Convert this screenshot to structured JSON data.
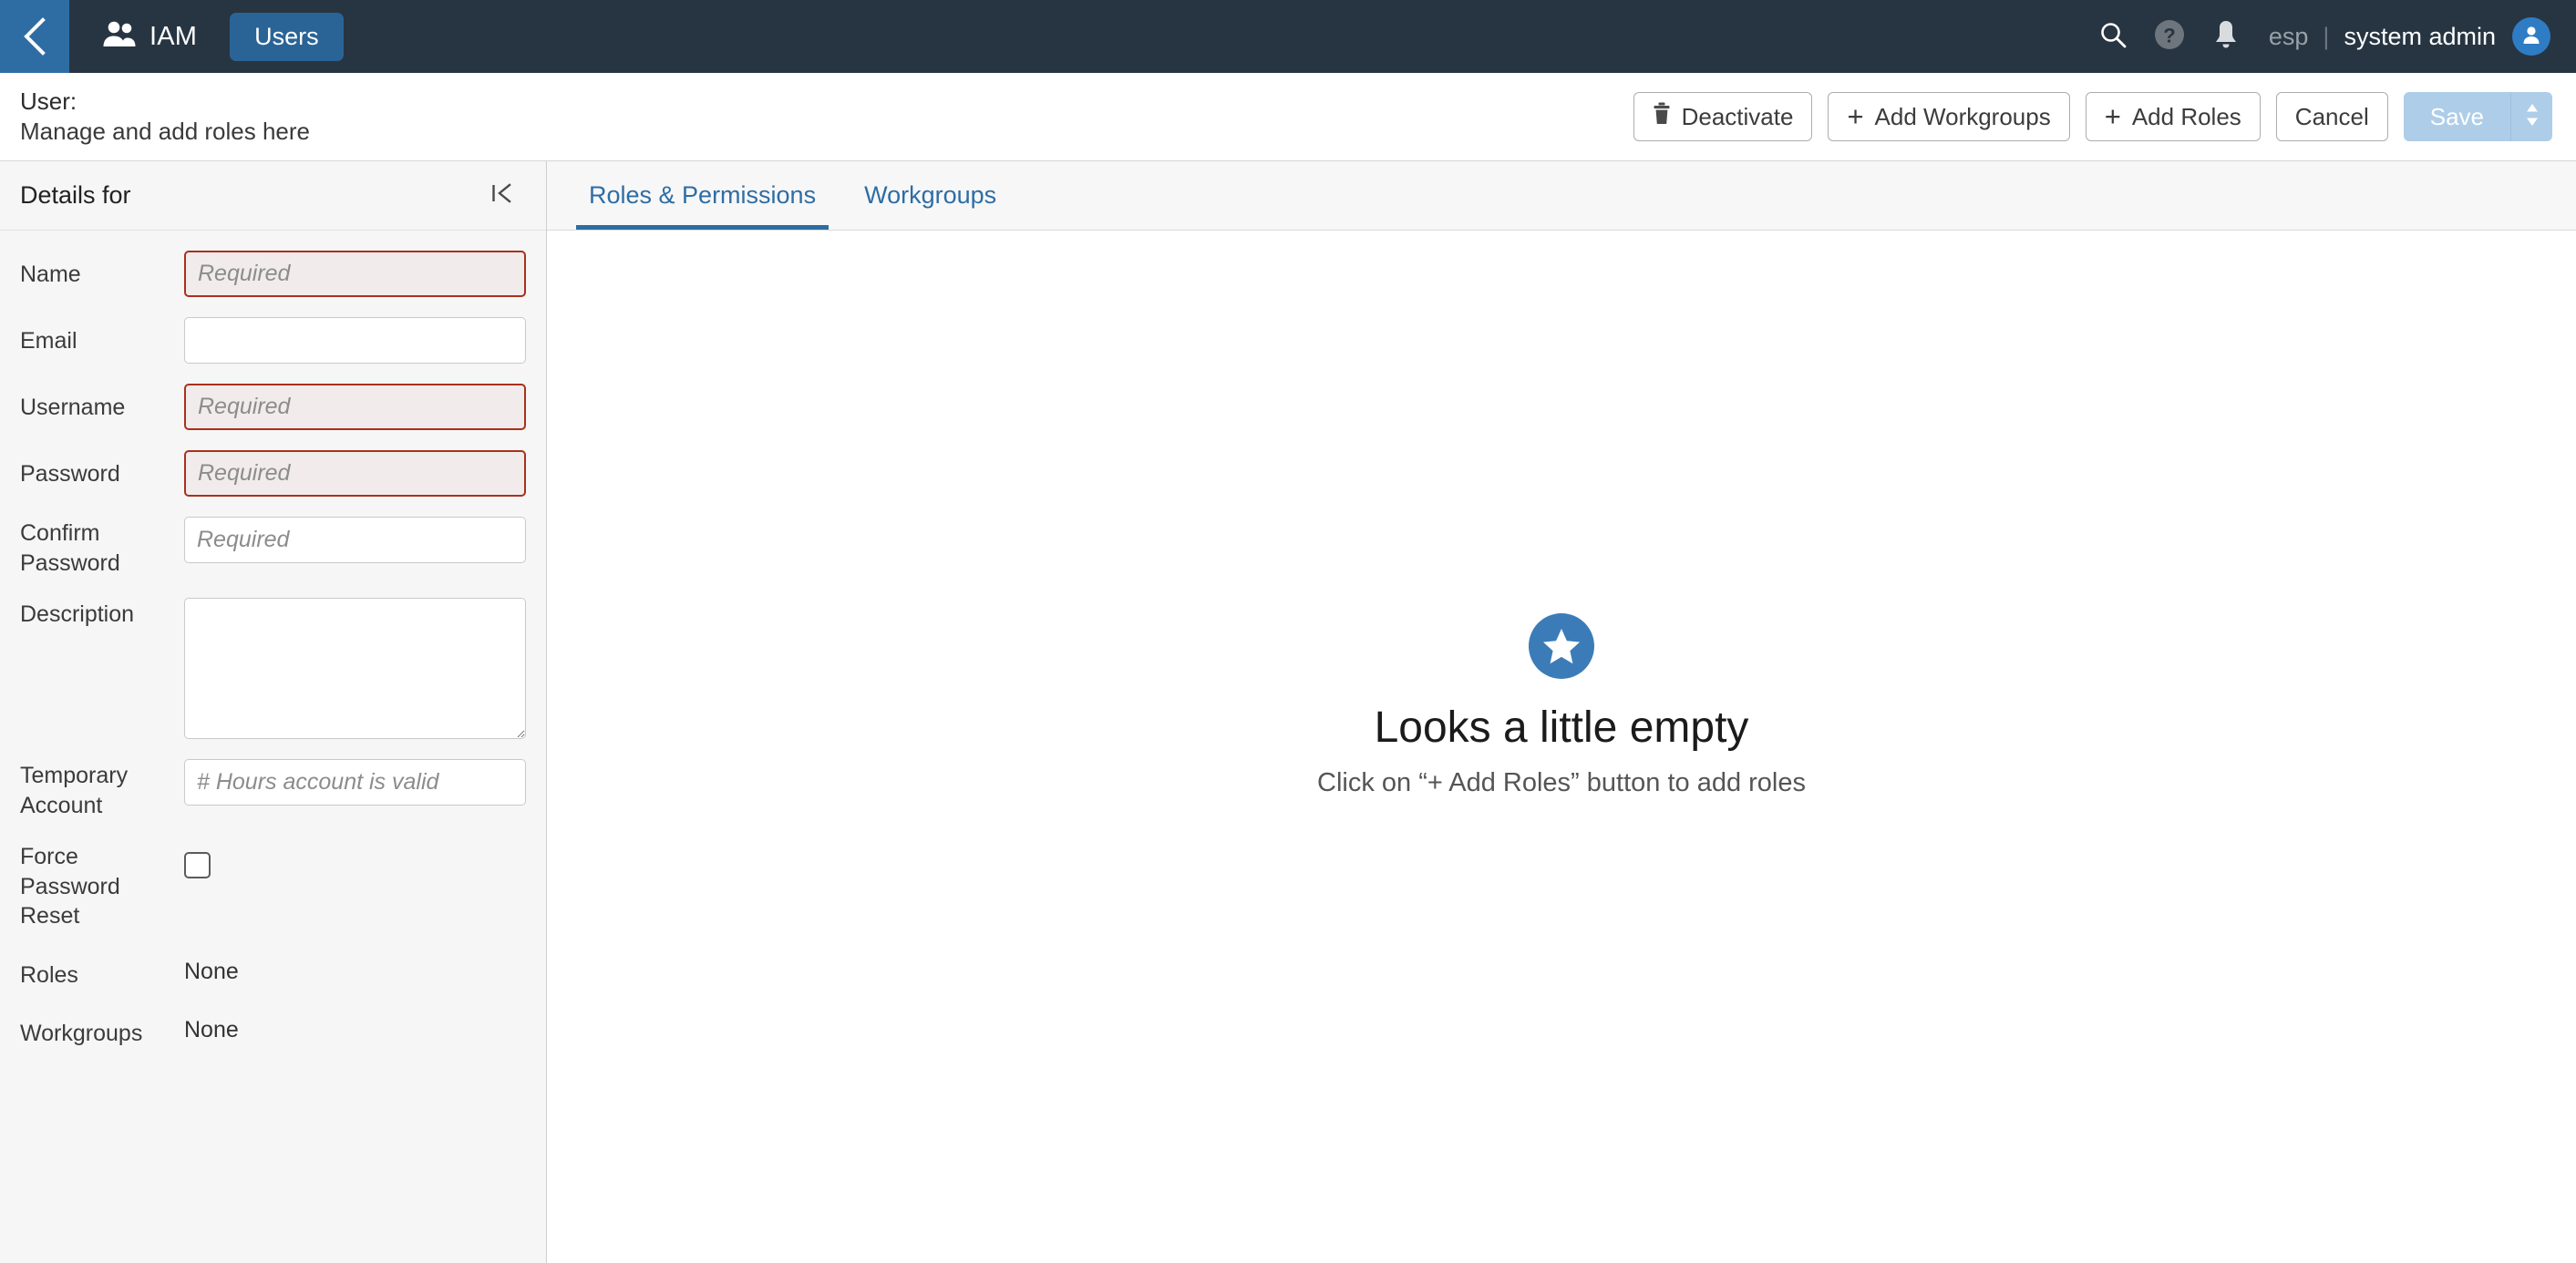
{
  "topbar": {
    "back_icon": "chevron-left-icon",
    "brand_icon": "people-icon",
    "brand_label": "IAM",
    "nav_tab_label": "Users",
    "search_icon": "search-icon",
    "help_icon": "help-circle-icon",
    "notifications_icon": "bell-icon",
    "language": "esp",
    "divider": "|",
    "username": "system admin",
    "avatar_icon": "user-avatar-icon",
    "bg_color": "#273542",
    "back_btn_color": "#2E6DA4",
    "nav_tab_color": "#2A6496"
  },
  "actionbar": {
    "title": "User:",
    "subtitle": "Manage and add roles here",
    "buttons": {
      "deactivate": "Deactivate",
      "add_workgroups": "Add Workgroups",
      "add_roles": "Add Roles",
      "cancel": "Cancel",
      "save": "Save",
      "plus": "+"
    },
    "save_disabled_color": "#AECDE8"
  },
  "sidebar": {
    "title": "Details for",
    "collapse_icon": "collapse-panel-icon",
    "fields": {
      "name": {
        "label": "Name",
        "value": "",
        "placeholder": "Required",
        "state": "error"
      },
      "email": {
        "label": "Email",
        "value": "",
        "placeholder": "",
        "state": "normal"
      },
      "username": {
        "label": "Username",
        "value": "",
        "placeholder": "Required",
        "state": "error"
      },
      "password": {
        "label": "Password",
        "value": "",
        "placeholder": "Required",
        "state": "error"
      },
      "confirm_password": {
        "label": "Confirm Password",
        "value": "",
        "placeholder": "Required",
        "state": "normal"
      },
      "description": {
        "label": "Description",
        "value": "",
        "placeholder": "",
        "state": "normal"
      },
      "temporary_account": {
        "label": "Temporary Account",
        "value": "",
        "placeholder": "# Hours account is valid",
        "state": "normal"
      },
      "force_password_reset": {
        "label": "Force Password Reset",
        "checked": false
      },
      "roles": {
        "label": "Roles",
        "value": "None"
      },
      "workgroups": {
        "label": "Workgroups",
        "value": "None"
      }
    }
  },
  "main": {
    "tabs": [
      {
        "label": "Roles & Permissions",
        "active": true
      },
      {
        "label": "Workgroups",
        "active": false
      }
    ],
    "empty_state": {
      "icon": "star-badge-icon",
      "title": "Looks a little empty",
      "subtitle": "Click on “+ Add Roles” button to add roles",
      "icon_color": "#3B7CB8"
    }
  }
}
